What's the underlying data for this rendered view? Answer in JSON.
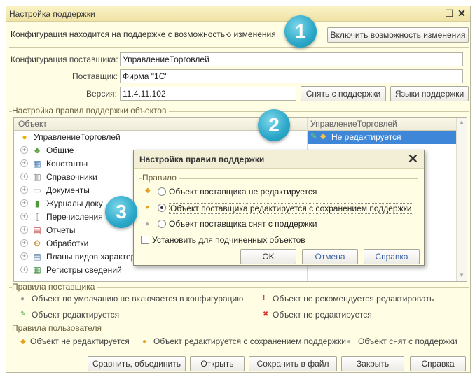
{
  "window": {
    "title": "Настройка поддержки",
    "info_text": "Конфигурация находится на поддержке с возможностью изменения",
    "enable_button": "Включить возможность изменения"
  },
  "config": {
    "supplier_config_label": "Конфигурация поставщика:",
    "supplier_config_value": "УправлениеТорговлей",
    "vendor_label": "Поставщик:",
    "vendor_value": "Фирма \"1С\"",
    "version_label": "Версия:",
    "version_value": "11.4.11.102",
    "remove_support_button": "Снять с поддержки",
    "support_languages_button": "Языки поддержки"
  },
  "rules_section": {
    "title": "Настройка правил поддержки объектов",
    "col_object": "Объект",
    "col_config": "УправлениеТорговлей",
    "selected_rule": "Не редактируется",
    "rows": [
      {
        "label": "УправлениеТорговлей",
        "icon": "config-root-icon"
      },
      {
        "label": "Общие",
        "icon": "common-icon"
      },
      {
        "label": "Константы",
        "icon": "constants-icon"
      },
      {
        "label": "Справочники",
        "icon": "catalogs-icon"
      },
      {
        "label": "Документы",
        "icon": "documents-icon"
      },
      {
        "label": "Журналы доку",
        "icon": "journals-icon"
      },
      {
        "label": "Перечисления",
        "icon": "enums-icon"
      },
      {
        "label": "Отчеты",
        "icon": "reports-icon"
      },
      {
        "label": "Обработки",
        "icon": "processing-icon"
      },
      {
        "label": "Планы видов характер",
        "icon": "chart-types-icon"
      },
      {
        "label": "Регистры сведений",
        "icon": "info-registers-icon"
      }
    ]
  },
  "badges": [
    "1",
    "2",
    "3"
  ],
  "dialog": {
    "title": "Настройка правил поддержки",
    "group_label": "Правило",
    "options": [
      "Объект поставщика не редактируется",
      "Объект поставщика редактируется с сохранением поддержки",
      "Объект поставщика снят с поддержки"
    ],
    "selected_option": 1,
    "checkbox_label": "Установить для подчиненных объектов",
    "ok": "OK",
    "cancel": "Отмена",
    "help": "Справка"
  },
  "legend_supplier": {
    "title": "Правила поставщика",
    "items": [
      "Объект по умолчанию не включается в конфигурацию",
      "Объект не рекомендуется редактировать",
      "Объект редактируется",
      "Объект не редактируется"
    ]
  },
  "legend_user": {
    "title": "Правила пользователя",
    "items": [
      "Объект не редактируется",
      "Объект редактируется с сохранением поддержки",
      "Объект снят с поддержки"
    ]
  },
  "bottom_buttons": {
    "compare": "Сравнить, объединить",
    "open": "Открыть",
    "save": "Сохранить в файл",
    "close": "Закрыть",
    "help": "Справка"
  },
  "colors": {
    "accent": "#3d86d8",
    "badge": "#2aa7c8",
    "window_bg": "#fffde3"
  }
}
